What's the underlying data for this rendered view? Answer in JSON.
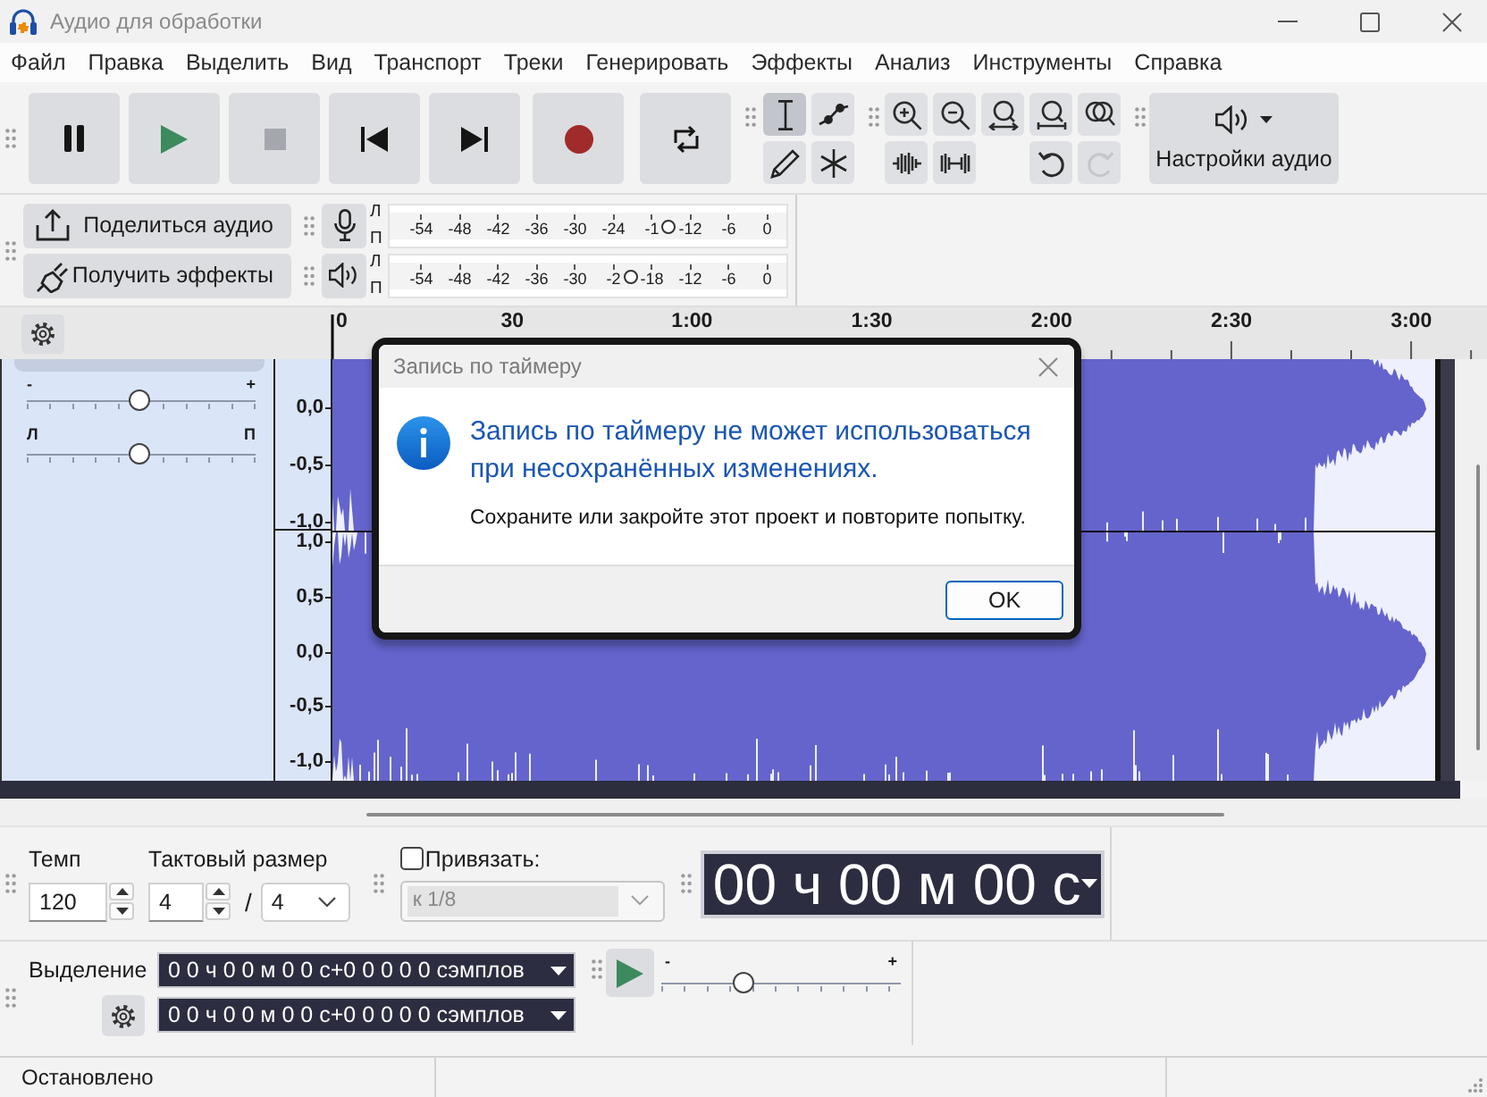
{
  "window": {
    "title": "Аудио для обработки"
  },
  "menu": [
    "Файл",
    "Правка",
    "Выделить",
    "Вид",
    "Транспорт",
    "Треки",
    "Генерировать",
    "Эффекты",
    "Анализ",
    "Инструменты",
    "Справка"
  ],
  "transport": [
    {
      "kind": "pause",
      "disabled": false
    },
    {
      "kind": "play",
      "disabled": false
    },
    {
      "kind": "stop",
      "disabled": true
    },
    {
      "kind": "skip-start",
      "disabled": false
    },
    {
      "kind": "skip-end",
      "disabled": false
    },
    {
      "kind": "record",
      "disabled": false
    },
    {
      "kind": "loop",
      "disabled": false
    }
  ],
  "tools": [
    {
      "kind": "select",
      "selected": true
    },
    {
      "kind": "envelope",
      "selected": false
    },
    {
      "kind": "draw",
      "selected": false
    },
    {
      "kind": "multi",
      "selected": false
    }
  ],
  "edit_tools": [
    {
      "kind": "zoom-in",
      "disabled": false
    },
    {
      "kind": "zoom-out",
      "disabled": false
    },
    {
      "kind": "fit-selection",
      "disabled": false
    },
    {
      "kind": "fit-project",
      "disabled": false
    },
    {
      "kind": "zoom-toggle",
      "disabled": false
    },
    {
      "kind": "trim",
      "disabled": false
    },
    {
      "kind": "silence",
      "disabled": false
    },
    {
      "kind": "undo",
      "disabled": false
    },
    {
      "kind": "redo",
      "disabled": true
    }
  ],
  "audio_setup": {
    "label": "Настройки аудио"
  },
  "share": [
    {
      "kind": "share",
      "label": "Поделиться аудио"
    },
    {
      "kind": "plug",
      "label": "Получить эффекты"
    }
  ],
  "meters": [
    {
      "kind": "record",
      "channels": [
        "Л",
        "П"
      ],
      "ticks": [
        "-54",
        "-48",
        "-42",
        "-36",
        "-30",
        "-24",
        "-1",
        "-12",
        "-6",
        "0"
      ],
      "level": 0.702
    },
    {
      "kind": "playback",
      "channels": [
        "Л",
        "П"
      ],
      "ticks": [
        "-54",
        "-48",
        "-42",
        "-36",
        "-30",
        "-2",
        "-18",
        "-12",
        "-6",
        "0"
      ],
      "level": 0.606
    }
  ],
  "timeline": {
    "ticks": [
      "0",
      "30",
      "1:00",
      "1:30",
      "2:00",
      "2:30",
      "3:00"
    ]
  },
  "track": {
    "gain": {
      "min": "-",
      "max": "+",
      "level": 0.49
    },
    "pan": {
      "min": "Л",
      "max": "П",
      "level": 0.49
    },
    "scale_upper": [
      "0,0",
      "-0,5",
      "-1,0"
    ],
    "scale_lower": [
      "1,0",
      "0,5",
      "0,0",
      "-0,5",
      "-1,0"
    ]
  },
  "tempo": {
    "label": "Темп",
    "value": "120"
  },
  "time_signature": {
    "label": "Тактовый размер",
    "upper": "4",
    "separator": "/",
    "lower": "4"
  },
  "snap": {
    "label": "Привязать:",
    "checked": false,
    "value": "к 1/8",
    "disabled": true
  },
  "time_display": {
    "value": "00 ч 00 м 00 с"
  },
  "selection": {
    "label": "Выделение",
    "start": "0 0 ч 0 0 м 0 0 с+0 0 0 0 0 сэмплов",
    "end": "0 0 ч 0 0 м 0 0 с+0 0 0 0 0 сэмплов"
  },
  "play_at_speed": {
    "min": "-",
    "max": "+",
    "level": 0.34
  },
  "status_bar": {
    "state": "Остановлено"
  },
  "dialog": {
    "title": "Запись по таймеру",
    "heading": "Запись по таймеру не может использоваться при несохранённых изменениях.",
    "message": "Сохраните или закройте этот проект и повторите попытку.",
    "buttons": [
      {
        "label": "OK",
        "default": true
      }
    ]
  }
}
